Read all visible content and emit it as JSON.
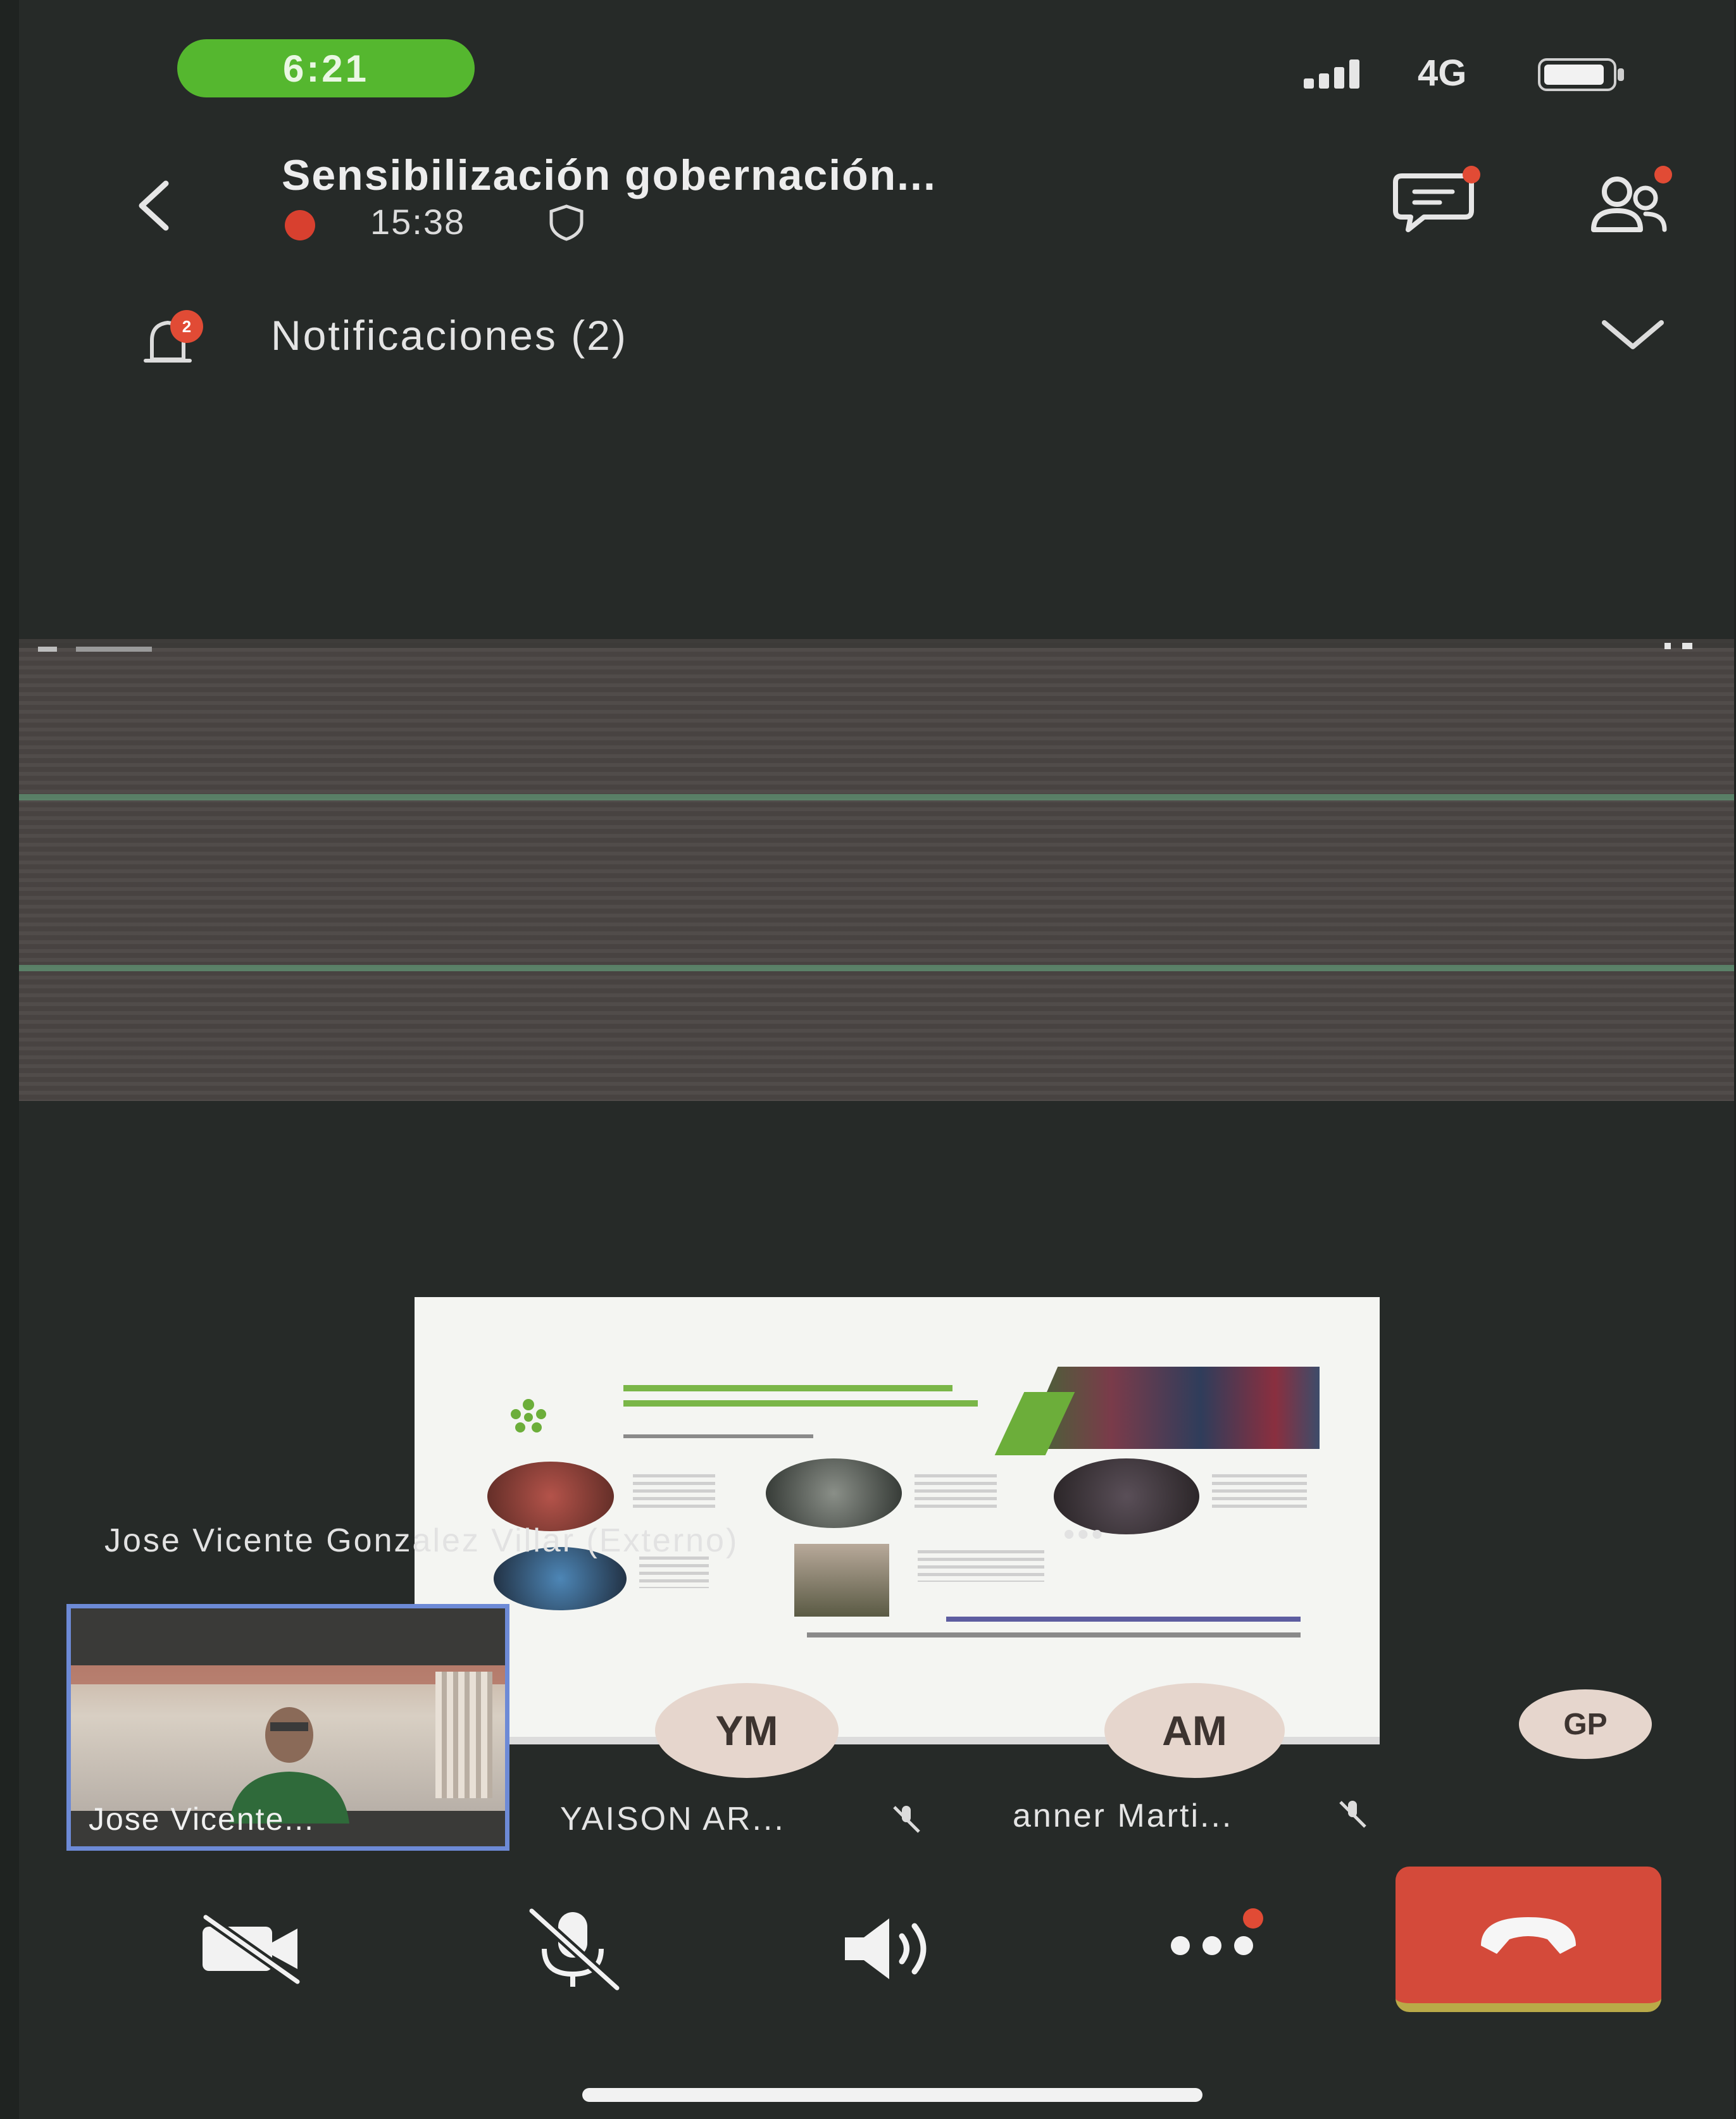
{
  "status_bar": {
    "time": "6:21",
    "network": "4G"
  },
  "header": {
    "title": "Sensibilización gobernación...",
    "duration": "15:38"
  },
  "notifications": {
    "label": "Notificaciones (2)"
  },
  "active_speaker": {
    "name": "Jose Vicente Gonzalez Villar (Externo)",
    "more": "•••"
  },
  "participants": [
    {
      "label": "Jose Vicente...",
      "type": "video"
    },
    {
      "initials": "YM",
      "label": "YAISON AR...",
      "muted": true
    },
    {
      "initials": "AM",
      "label": "anner Marti...",
      "muted": true
    },
    {
      "initials": "GP",
      "label": ""
    }
  ],
  "colors": {
    "time_pill": "#55b72f",
    "recording_dot": "#d8402f",
    "badge": "#e14b35",
    "end_call": "#d44a3a",
    "active_tile_border": "#6d8ad6",
    "avatar_bg": "#e6d6cd"
  },
  "icons": {
    "back": "chevron-left-icon",
    "shield": "shield-icon",
    "chat": "chat-icon",
    "participants": "participants-icon",
    "notification": "bell-icon",
    "expand": "chevron-down-icon",
    "camera_off": "camera-off-icon",
    "mic_off": "mic-off-icon",
    "speaker": "speaker-icon",
    "more": "more-icon",
    "end_call": "end-call-icon"
  }
}
